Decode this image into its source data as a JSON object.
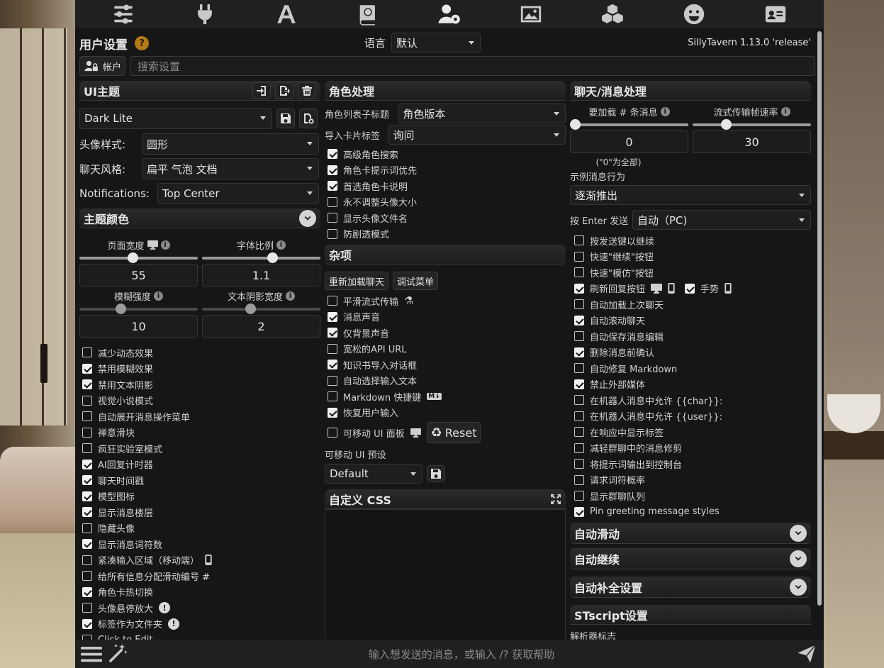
{
  "topbar": {
    "icons": [
      "sliders-icon",
      "plug-icon",
      "font-icon",
      "book-icon",
      "user-gear-icon",
      "image-icon",
      "cubes-icon",
      "smile-icon",
      "id-card-icon"
    ],
    "active": "user-gear-icon"
  },
  "header": {
    "title": "用户设置",
    "help": "?",
    "language_label": "语言",
    "language_value": "默认",
    "version": "SillyTavern 1.13.0 'release'"
  },
  "account": {
    "button_label": "帐户",
    "search_placeholder": "搜索设置"
  },
  "ui_theme": {
    "title": "UI主题",
    "theme_value": "Dark Lite",
    "avatar_style_label": "头像样式:",
    "avatar_style_value": "圆形",
    "chat_style_label": "聊天风格:",
    "chat_style_value": "扁平 气泡 文档",
    "notifications_label": "Notifications:",
    "notifications_value": "Top Center",
    "theme_colors": "主题颜色",
    "page_width_label": "页面宽度",
    "page_width_value": "55",
    "page_width_fraction": 0.45,
    "font_scale_label": "字体比例",
    "font_scale_value": "1.1",
    "font_scale_fraction": 0.59,
    "blur_label": "模糊强度",
    "blur_value": "10",
    "blur_fraction": 0.35,
    "shadow_label": "文本阴影宽度",
    "shadow_value": "2",
    "shadow_fraction": 0.41,
    "checkboxes": [
      {
        "label": "减少动态效果",
        "checked": false
      },
      {
        "label": "禁用模糊效果",
        "checked": true
      },
      {
        "label": "禁用文本阴影",
        "checked": true
      },
      {
        "label": "视觉小说模式",
        "checked": false
      },
      {
        "label": "自动展开消息操作菜单",
        "checked": false
      },
      {
        "label": "禅意滑块",
        "checked": false
      },
      {
        "label": "疯狂实验室模式",
        "checked": false
      },
      {
        "label": "AI回复计时器",
        "checked": true
      },
      {
        "label": "聊天时间戳",
        "checked": true
      },
      {
        "label": "模型图标",
        "checked": true
      },
      {
        "label": "显示消息楼层",
        "checked": true
      },
      {
        "label": "隐藏头像",
        "checked": false
      },
      {
        "label": "显示消息词符数",
        "checked": true
      },
      {
        "label": "紧凑输入区域（移动端）",
        "checked": false
      },
      {
        "label": "给所有信息分配滑动编号 #",
        "checked": false
      },
      {
        "label": "角色卡热切换",
        "checked": true
      },
      {
        "label": "头像悬停放大",
        "checked": false
      },
      {
        "label": "标签作为文件夹",
        "checked": true
      },
      {
        "label": "Click to Edit",
        "checked": false
      }
    ]
  },
  "character": {
    "title": "角色处理",
    "list_subtitle_label": "角色列表子标题",
    "list_subtitle_value": "角色版本",
    "import_tags_label": "导入卡片标签",
    "import_tags_value": "询问",
    "checkboxes": [
      {
        "label": "高级角色搜索",
        "checked": true
      },
      {
        "label": "角色卡提示词优先",
        "checked": true
      },
      {
        "label": "首选角色卡说明",
        "checked": true
      },
      {
        "label": "永不调整头像大小",
        "checked": false
      },
      {
        "label": "显示头像文件名",
        "checked": false
      },
      {
        "label": "防剧透模式",
        "checked": false
      }
    ]
  },
  "misc": {
    "title": "杂项",
    "reload_chat": "重新加载聊天",
    "debug_menu": "调试菜单",
    "checkboxes": [
      {
        "label": "平滑流式传输",
        "checked": false
      },
      {
        "label": "消息声音",
        "checked": true
      },
      {
        "label": "仅背景声音",
        "checked": true
      },
      {
        "label": "宽松的API URL",
        "checked": false
      },
      {
        "label": "知识书导入对话框",
        "checked": true
      },
      {
        "label": "自动选择输入文本",
        "checked": false
      },
      {
        "label": "Markdown 快捷键",
        "checked": false
      },
      {
        "label": "恢复用户输入",
        "checked": true
      }
    ],
    "movable_panels_label": "可移动 UI 面板",
    "movable_panels_checked": false,
    "reset_label": "Reset",
    "movable_preset_label": "可移动 UI 预设",
    "movable_preset_value": "Default",
    "custom_css_title": "自定义 CSS"
  },
  "chat": {
    "title": "聊天/消息处理",
    "load_msgs_label": "要加载 # 条消息",
    "load_msgs_value": "0",
    "load_msgs_fraction": 0.0,
    "load_msgs_hint": "(\"0\"为全部)",
    "stream_fps_label": "流式传输帧速率",
    "stream_fps_value": "30",
    "stream_fps_fraction": 0.28,
    "example_behavior_label": "示例消息行为",
    "example_behavior_value": "逐渐推出",
    "enter_send_label": "按 Enter 发送",
    "enter_send_value": "自动（PC)",
    "gesture_label": "手势",
    "checkboxes": [
      {
        "label": "按发送键以继续",
        "checked": false
      },
      {
        "label": "快速\"继续\"按钮",
        "checked": false
      },
      {
        "label": "快速\"模仿\"按钮",
        "checked": false
      },
      {
        "label": "刷新回复按钮",
        "checked": true
      },
      {
        "label": "自动加载上次聊天",
        "checked": false
      },
      {
        "label": "自动滚动聊天",
        "checked": true
      },
      {
        "label": "自动保存消息编辑",
        "checked": false
      },
      {
        "label": "删除消息前确认",
        "checked": true
      },
      {
        "label": "自动修复 Markdown",
        "checked": false
      },
      {
        "label": "禁止外部媒体",
        "checked": true
      },
      {
        "label": "在机器人消息中允许 {{char}}:",
        "checked": false
      },
      {
        "label": "在机器人消息中允许 {{user}}:",
        "checked": false
      },
      {
        "label": "在响应中显示标签",
        "checked": false
      },
      {
        "label": "减轻群聊中的消息修剪",
        "checked": false
      },
      {
        "label": "将提示词输出到控制台",
        "checked": false
      },
      {
        "label": "请求词符概率",
        "checked": false
      },
      {
        "label": "显示群聊队列",
        "checked": false
      },
      {
        "label": "Pin greeting message styles",
        "checked": true
      }
    ],
    "auto_swipe": "自动滑动",
    "auto_continue": "自动继续",
    "autocomplete": "自动补全设置",
    "stscript": "STscript设置",
    "parser_flags": "解析器标志"
  },
  "bottom": {
    "placeholder": "输入想发送的消息，或输入 /? 获取帮助"
  }
}
